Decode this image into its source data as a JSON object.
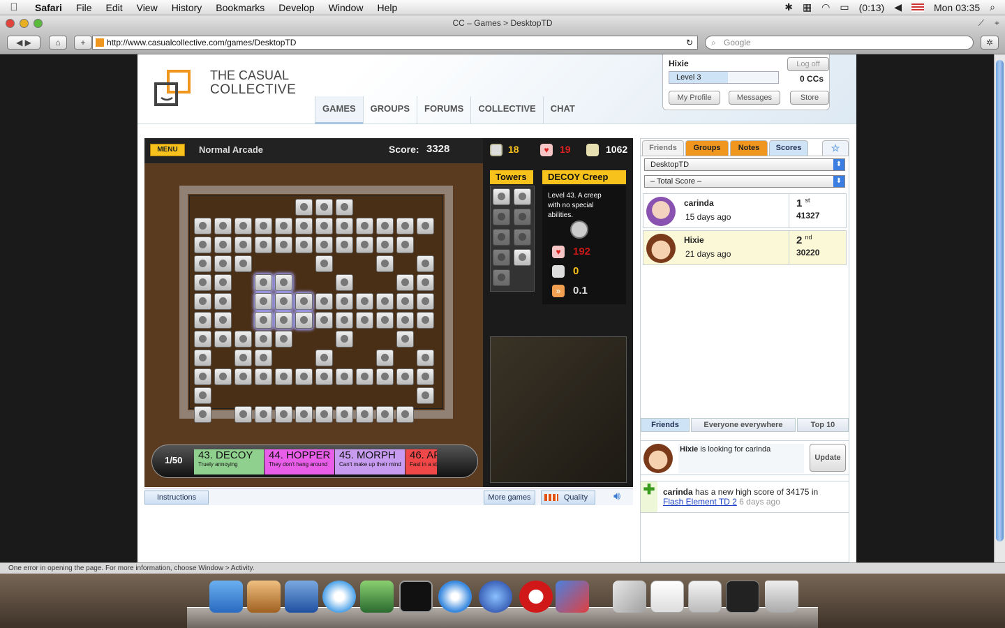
{
  "menubar": {
    "app": "Safari",
    "items": [
      "File",
      "Edit",
      "View",
      "History",
      "Bookmarks",
      "Develop",
      "Window",
      "Help"
    ],
    "battery": "(0:13)",
    "clock": "Mon 03:35"
  },
  "window": {
    "title": "CC – Games > DesktopTD",
    "url": "http://www.casualcollective.com/games/DesktopTD",
    "search_placeholder": "Google"
  },
  "site": {
    "brand_line1": "THE CASUAL",
    "brand_line2": "COLLECTIVE",
    "nav": [
      "GAMES",
      "GROUPS",
      "FORUMS",
      "COLLECTIVE",
      "CHAT"
    ],
    "user": {
      "name": "Hixie",
      "level": "Level 3",
      "ccs": "0 CCs",
      "logoff": "Log off",
      "profile": "My Profile",
      "messages": "Messages",
      "store": "Store"
    }
  },
  "game": {
    "menu_label": "MENU",
    "mode": "Normal Arcade",
    "score_label": "Score:",
    "score": "3328",
    "gold": "18",
    "lives": "19",
    "credits": "1062",
    "towers_label": "Towers",
    "creep_title": "DECOY Creep",
    "creep_desc": "Level 43. A creep with no special abilities.",
    "creep_hp": "192",
    "creep_bounty": "0",
    "creep_speed": "0.1",
    "wave_counter": "1/50",
    "waves": [
      {
        "name": "43. DECOY",
        "desc": "Truely annoying",
        "color": "#8fd08f"
      },
      {
        "name": "44. HOPPER",
        "desc": "They don't hang around",
        "color": "#e85ee8"
      },
      {
        "name": "45. MORPH",
        "desc": "Can't make up their mind",
        "color": "#c79cf0"
      },
      {
        "name": "46. AF",
        "desc": "Fast in a st",
        "color": "#f04848"
      }
    ],
    "instructions": "Instructions",
    "more_games": "More games",
    "quality": "Quality"
  },
  "panel": {
    "tabs": [
      "Friends",
      "Groups",
      "Notes",
      "Scores"
    ],
    "game_select": "DesktopTD",
    "score_select": "– Total Score –",
    "scores": [
      {
        "name": "carinda",
        "time": "15 days ago",
        "rank": "1",
        "suffix": "st",
        "score": "41327"
      },
      {
        "name": "Hixie",
        "time": "21 days ago",
        "rank": "2",
        "suffix": "nd",
        "score": "30220"
      }
    ],
    "bottom_tabs": [
      "Friends",
      "Everyone everywhere",
      "Top 10"
    ],
    "status_name": "Hixie",
    "status_text": "is looking for carinda",
    "update": "Update",
    "feed_name": "carinda",
    "feed_text": "has a new high score of 34175 in",
    "feed_link": "Flash Element TD 2",
    "feed_time": "6 days ago"
  },
  "statusbar": "One error in opening the page. For more information, choose Window > Activity.",
  "colors": {
    "accent_orange": "#f0961e",
    "gold": "#f8c21c",
    "link": "#1a3fc4"
  }
}
